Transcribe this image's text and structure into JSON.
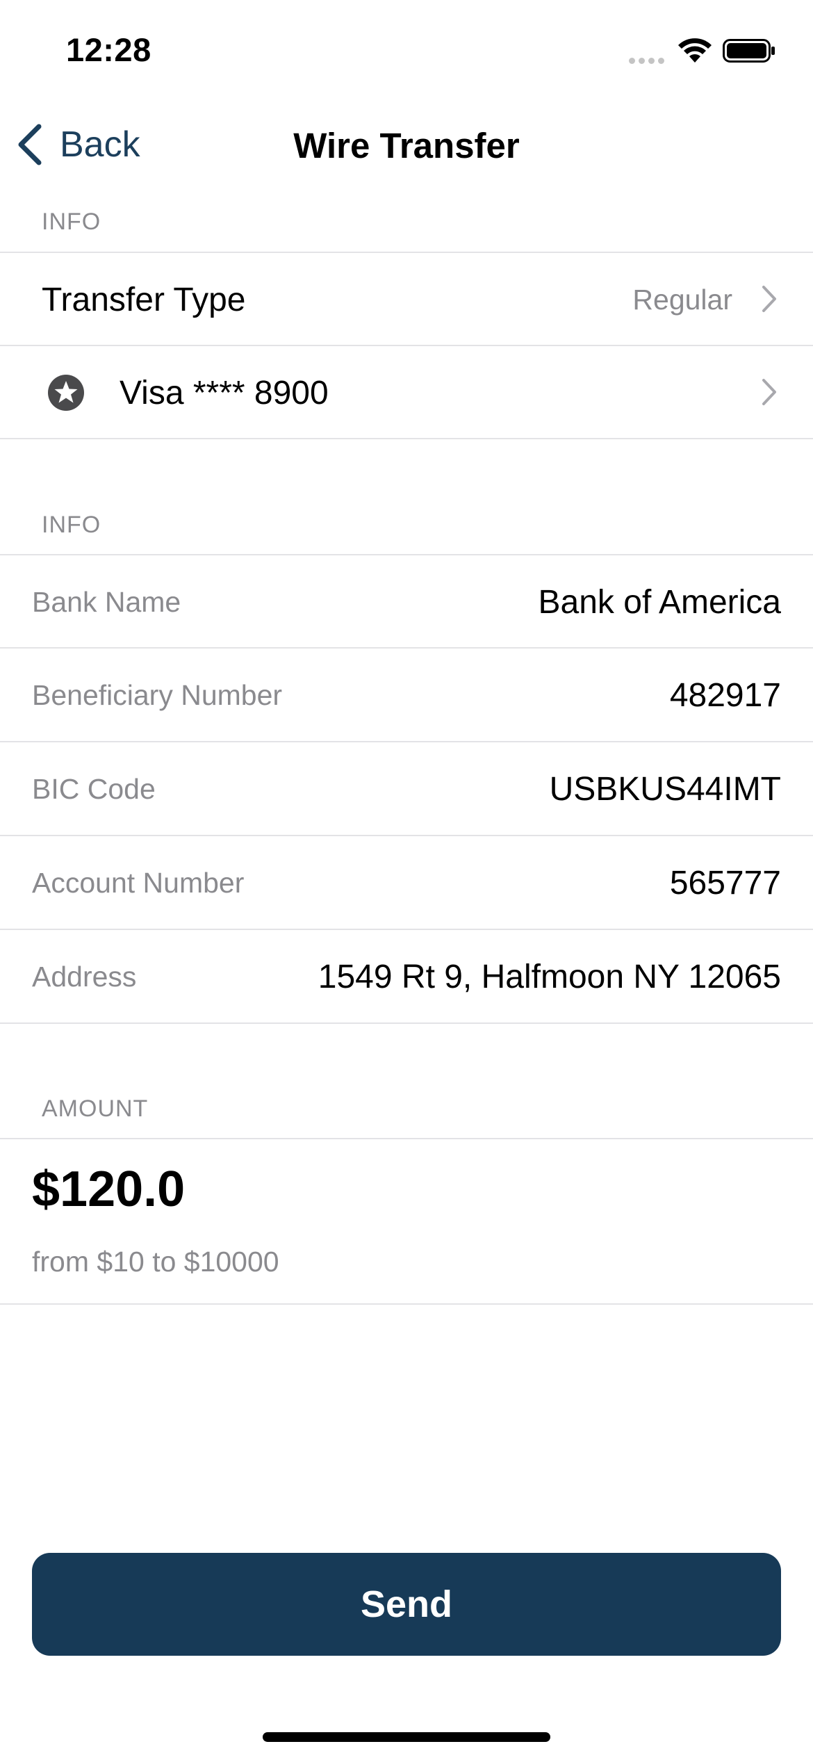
{
  "status_bar": {
    "time": "12:28"
  },
  "nav": {
    "back_label": "Back",
    "title": "Wire Transfer"
  },
  "section_info_1": {
    "header": "INFO",
    "transfer_type": {
      "label": "Transfer Type",
      "value": "Regular"
    },
    "card": {
      "label": "Visa **** 8900",
      "icon": "star-circle-icon"
    }
  },
  "section_info_2": {
    "header": "INFO",
    "fields": [
      {
        "label": "Bank Name",
        "value": "Bank of America"
      },
      {
        "label": "Beneficiary Number",
        "value": "482917"
      },
      {
        "label": "BIC Code",
        "value": "USBKUS44IMT"
      },
      {
        "label": "Account Number",
        "value": "565777"
      },
      {
        "label": "Address",
        "value": "1549 Rt 9, Halfmoon NY 12065"
      }
    ]
  },
  "section_amount": {
    "header": "AMOUNT",
    "value": "$120.0",
    "range": "from $10 to $10000"
  },
  "send_button": {
    "label": "Send"
  },
  "colors": {
    "accent": "#1c3f5c",
    "button_bg": "#173a57",
    "muted_text": "#8a8a8e",
    "divider": "#e3e3e6"
  }
}
